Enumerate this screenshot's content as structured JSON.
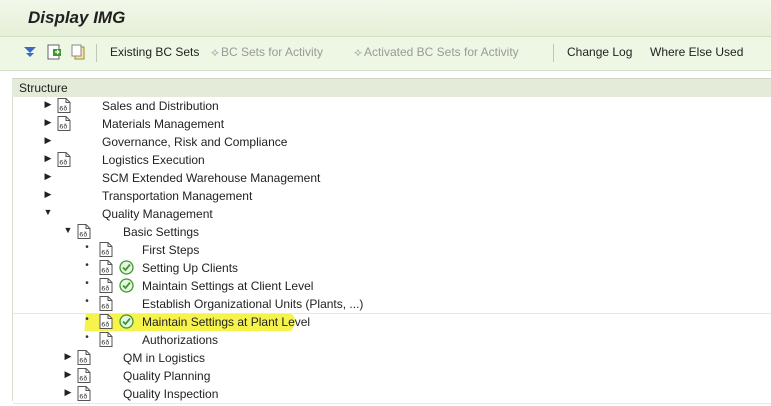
{
  "window": {
    "title": "Display IMG"
  },
  "toolbar": {
    "existing_bc_sets": "Existing BC Sets",
    "bc_sets_for_activity": "BC Sets for Activity",
    "activated_bc_sets_for_activity": "Activated BC Sets for Activity",
    "change_log": "Change Log",
    "where_else_used": "Where Else Used"
  },
  "structure": {
    "header": "Structure",
    "items": [
      {
        "label": "Sales and Distribution",
        "level": 0,
        "expanded": false,
        "doc": true,
        "clock": false
      },
      {
        "label": "Materials Management",
        "level": 0,
        "expanded": false,
        "doc": true,
        "clock": false
      },
      {
        "label": "Governance, Risk and Compliance",
        "level": 0,
        "expanded": false,
        "doc": false,
        "clock": false
      },
      {
        "label": "Logistics Execution",
        "level": 0,
        "expanded": false,
        "doc": true,
        "clock": false
      },
      {
        "label": "SCM Extended Warehouse Management",
        "level": 0,
        "expanded": false,
        "doc": false,
        "clock": false
      },
      {
        "label": "Transportation Management",
        "level": 0,
        "expanded": false,
        "doc": false,
        "clock": false
      },
      {
        "label": "Quality Management",
        "level": 0,
        "expanded": true,
        "doc": false,
        "clock": false
      },
      {
        "label": "Basic Settings",
        "level": 1,
        "expanded": true,
        "doc": true,
        "clock": false
      },
      {
        "label": "First Steps",
        "level": 2,
        "leaf": true,
        "doc": true,
        "clock": false
      },
      {
        "label": "Setting Up Clients",
        "level": 2,
        "leaf": true,
        "doc": true,
        "clock": true
      },
      {
        "label": "Maintain Settings at Client Level",
        "level": 2,
        "leaf": true,
        "doc": true,
        "clock": true
      },
      {
        "label": "Establish Organizational Units (Plants, ...)",
        "level": 2,
        "leaf": true,
        "doc": true,
        "clock": false
      },
      {
        "label": "Maintain Settings at Plant Level",
        "level": 2,
        "leaf": true,
        "doc": true,
        "clock": true,
        "highlighted": true
      },
      {
        "label": "Authorizations",
        "level": 2,
        "leaf": true,
        "doc": true,
        "clock": false
      },
      {
        "label": "QM in Logistics",
        "level": 1,
        "expanded": false,
        "doc": true,
        "clock": false
      },
      {
        "label": "Quality Planning",
        "level": 1,
        "expanded": false,
        "doc": true,
        "clock": false
      },
      {
        "label": "Quality Inspection",
        "level": 1,
        "expanded": false,
        "doc": true,
        "clock": false
      }
    ]
  },
  "colors": {
    "title_bg": "#e6efd8",
    "toolbar_bg": "#eef6e4",
    "header_bg": "#e4ebd9",
    "highlight": "#f5f23a",
    "clock_green": "#3c9a2e"
  },
  "icons": {
    "expand_all": "expand-all-icon",
    "save_variant": "save-variant-icon",
    "copy": "copy-icon",
    "bc_set": "bc-set-icon",
    "doc": "documentation-icon",
    "clock": "execute-clock-icon"
  }
}
